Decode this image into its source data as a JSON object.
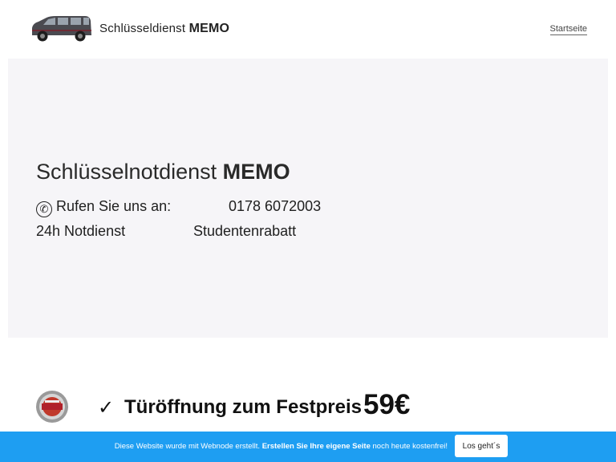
{
  "header": {
    "brand_prefix": "Schlüsseldienst",
    "brand_bold": "MEMO",
    "nav": [
      "Startseite"
    ]
  },
  "hero": {
    "title_prefix": "Schlüsselnotdienst",
    "title_bold": "MEMO",
    "call_label": "Rufen Sie uns an:",
    "phone": "0178 6072003",
    "service_1": "24h Notdienst",
    "service_2": "Studentenrabatt",
    "phone_icon": "phone-icon"
  },
  "offer": {
    "badge_icon": "24h-notdienst-badge",
    "check": "✓",
    "text": "Türöffnung zum Festpreis",
    "price": "59€"
  },
  "cookie_bar": {
    "text_pre": "Diese Website wurde mit Webnode erstellt.",
    "text_link": "Erstellen Sie Ihre eigene Seite",
    "text_post": "noch heute kostenfrei!",
    "button": "Los geht´s",
    "bg_color": "#1e9ef2"
  }
}
